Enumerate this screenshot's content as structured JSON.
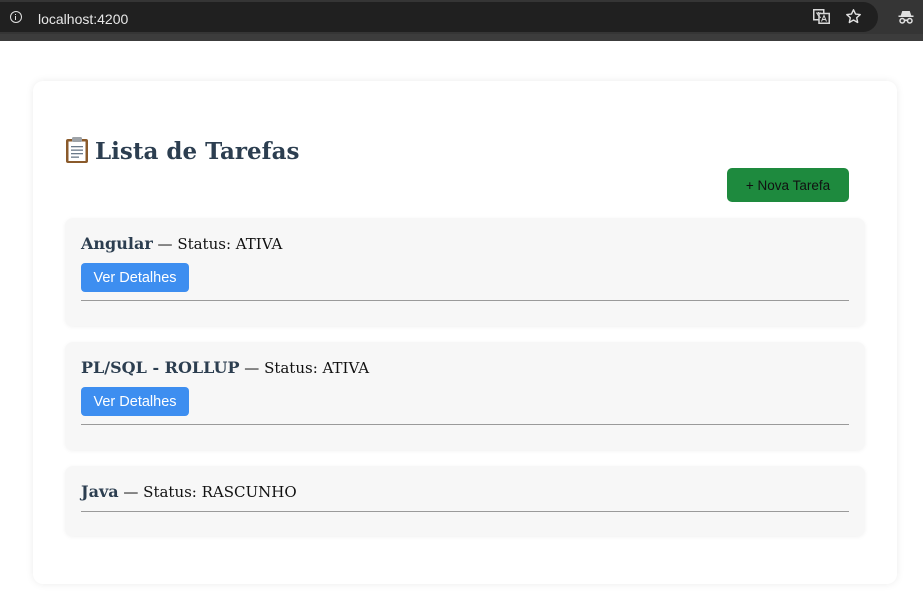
{
  "browser": {
    "url": "localhost:4200"
  },
  "page": {
    "title": "Lista de Tarefas",
    "new_task_label": "+ Nova Tarefa",
    "status_prefix": "Status:",
    "separator": "—",
    "details_label": "Ver Detalhes"
  },
  "tasks": [
    {
      "name": "Angular",
      "status": "ATIVA",
      "has_details": true
    },
    {
      "name": "PL/SQL - ROLLUP",
      "status": "ATIVA",
      "has_details": true
    },
    {
      "name": "Java",
      "status": "RASCUNHO",
      "has_details": false
    }
  ],
  "colors": {
    "new_task_button": "#1e8a3e",
    "details_button": "#3d8ef0",
    "title": "#2c3e50"
  },
  "icons": {
    "title_icon": "clipboard-icon",
    "address_icon": "info-icon",
    "toolbar": [
      "translate-icon",
      "star-icon",
      "incognito-icon"
    ]
  }
}
